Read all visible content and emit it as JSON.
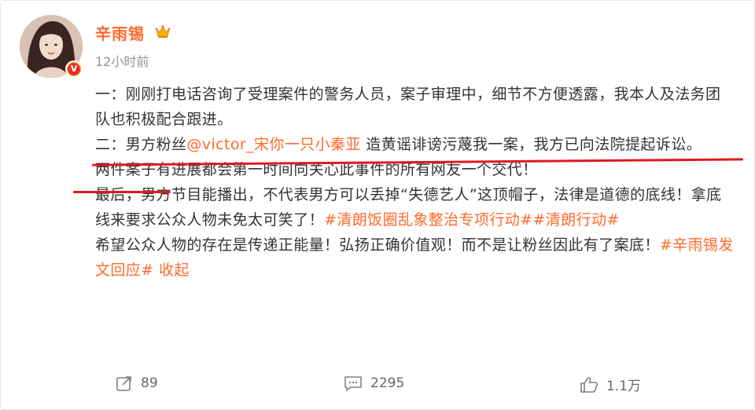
{
  "post": {
    "author": "辛雨锡",
    "time": "12小时前",
    "verified_badge": "V",
    "line1": "一：刚刚打电话咨询了受理案件的警务人员，案子审理中，细节不方便透露，我本人及法务团队也积极配合跟进。",
    "line2_prefix": "二：男方粉丝",
    "line2_mention": "@victor_宋你一只小秦亚",
    "line2_suffix": " 造黄谣诽谤污蔑我一案，我方已向法院提起诉讼。",
    "line3": "两件案子有进展都会第一时间向关心此事件的所有网友一个交代！",
    "line4_text": "最后，男方节目能播出，不代表男方可以丢掉“失德艺人”这顶帽子，法律是道德的底线！拿底线来要求公众人物未免太可笑了！",
    "line4_tag1": "#清朗饭圈乱象整治专项行动#",
    "line4_tag2": "#清朗行动#",
    "line5_text": "希望公众人物的存在是传递正能量！弘扬正确价值观！而不是让粉丝因此有了案底！",
    "line5_tag": "#辛雨锡发文回应#",
    "collapse": "收起"
  },
  "actions": {
    "repost_count": "89",
    "comment_count": "2295",
    "like_count": "1.1万"
  },
  "colors": {
    "accent": "#ff6a2b",
    "underline_mark": "#e0181f",
    "text": "#333333",
    "muted": "#939393"
  },
  "icons": [
    "crown-icon",
    "verified-v-icon",
    "repost-icon",
    "comment-icon",
    "like-icon"
  ]
}
